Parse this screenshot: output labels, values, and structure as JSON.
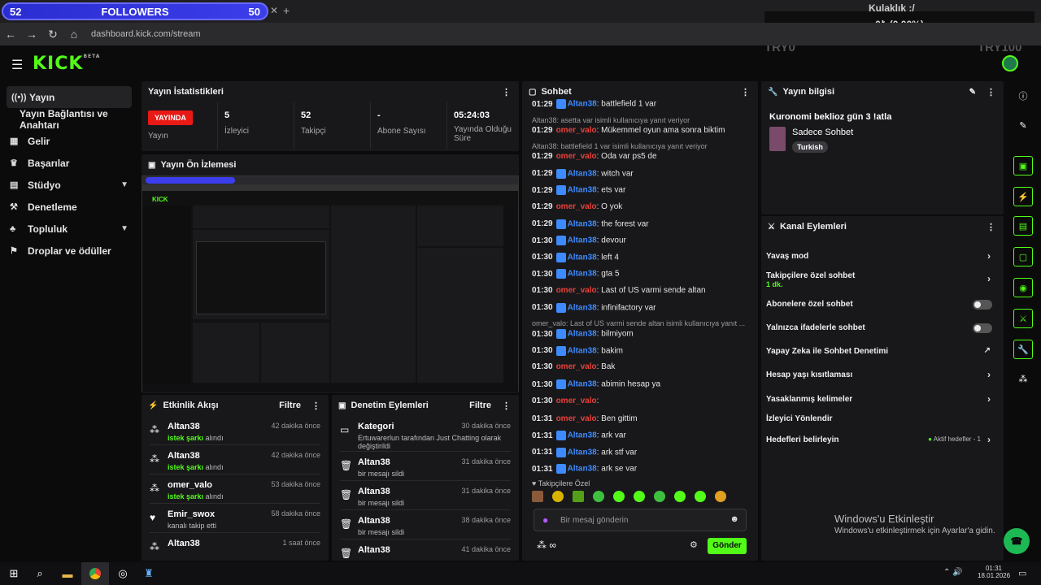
{
  "overlay": {
    "followers_left": "52",
    "followers_label": "FOLLOWERS",
    "followers_right": "50",
    "top_title": "Kulaklık :/",
    "top_amount": "0₺ (0.00%)",
    "try0": "TRY0",
    "try100": "TRY100"
  },
  "browser": {
    "url": "dashboard.kick.com/stream"
  },
  "logo": {
    "text": "KICK",
    "beta": "BETA"
  },
  "sidebar": {
    "items": [
      {
        "label": "Yayın",
        "icon": "broadcast-icon"
      },
      {
        "label": "Yayın Bağlantısı ve Anahtarı",
        "icon": ""
      },
      {
        "label": "Gelir",
        "icon": "revenue-icon"
      },
      {
        "label": "Başarılar",
        "icon": "trophy-icon"
      },
      {
        "label": "Stüdyo",
        "icon": "studio-icon"
      },
      {
        "label": "Denetleme",
        "icon": "moderation-icon"
      },
      {
        "label": "Topluluk",
        "icon": "community-icon"
      },
      {
        "label": "Droplar ve ödüller",
        "icon": "drops-icon"
      }
    ]
  },
  "stats": {
    "title": "Yayın İstatistikleri",
    "live": "YAYINDA",
    "live_label": "Yayın",
    "viewers": "5",
    "viewers_label": "İzleyici",
    "followers": "52",
    "followers_label": "Takipçi",
    "subs": "-",
    "subs_label": "Abone Sayısı",
    "uptime": "05:24:03",
    "uptime_label": "Yayında Olduğu Süre"
  },
  "preview": {
    "title": "Yayın Ön İzlemesi"
  },
  "activity": {
    "title": "Etkinlik Akışı",
    "filter": "Filtre",
    "rows": [
      {
        "name": "Altan38",
        "sub_b": "istek şarkı",
        "sub": " alındı",
        "time": "42 dakika önce"
      },
      {
        "name": "Altan38",
        "sub_b": "istek şarkı",
        "sub": " alındı",
        "time": "42 dakika önce"
      },
      {
        "name": "omer_valo",
        "sub_b": "istek şarkı",
        "sub": " alındı",
        "time": "53 dakika önce"
      },
      {
        "name": "Emir_swox",
        "sub_b": "",
        "sub": "kanalı takip etti",
        "time": "58 dakika önce"
      },
      {
        "name": "Altan38",
        "sub_b": "",
        "sub": "",
        "time": "1 saat önce"
      }
    ]
  },
  "modactions": {
    "title": "Denetim Eylemleri",
    "filter": "Filtre",
    "rows": [
      {
        "name": "Kategori",
        "time": "30 dakika önce",
        "sub": "Ertuwarerlun tarafından Just Chatting olarak değiştirildi"
      },
      {
        "name": "Altan38",
        "time": "31 dakika önce",
        "sub": "bir mesajı sildi"
      },
      {
        "name": "Altan38",
        "time": "31 dakika önce",
        "sub": "bir mesajı sildi"
      },
      {
        "name": "Altan38",
        "time": "38 dakika önce",
        "sub": "bir mesajı sildi"
      },
      {
        "name": "Altan38",
        "time": "41 dakika önce",
        "sub": ""
      }
    ]
  },
  "chat": {
    "title": "Sohbet",
    "followers_only": "Takipçilere Özel",
    "placeholder": "Bir mesaj gönderin",
    "send": "Gönder",
    "messages": [
      {
        "type": "msg",
        "time": "01:29",
        "user": "Altan38",
        "uc": "u1",
        "text": ": battlefield 1 var"
      },
      {
        "type": "reply",
        "text": "Altan38: asetta var isimli kullanıcıya yanıt veriyor"
      },
      {
        "type": "msg",
        "time": "01:29",
        "user": "omer_valo",
        "uc": "u2",
        "text": ": Mükemmel oyun ama sonra biktim"
      },
      {
        "type": "reply",
        "text": "Altan38: battlefield 1 var isimli kullanıcıya yanıt veriyor"
      },
      {
        "type": "msg",
        "time": "01:29",
        "user": "omer_valo",
        "uc": "u2",
        "text": ": Oda var ps5 de"
      },
      {
        "type": "msg",
        "time": "01:29",
        "user": "Altan38",
        "uc": "u1",
        "text": ": witch var"
      },
      {
        "type": "msg",
        "time": "01:29",
        "user": "Altan38",
        "uc": "u1",
        "text": ": ets var"
      },
      {
        "type": "msg",
        "time": "01:29",
        "user": "omer_valo",
        "uc": "u2",
        "text": ": O yok"
      },
      {
        "type": "msg",
        "time": "01:29",
        "user": "Altan38",
        "uc": "u1",
        "text": ": the forest var"
      },
      {
        "type": "msg",
        "time": "01:30",
        "user": "Altan38",
        "uc": "u1",
        "text": ": devour"
      },
      {
        "type": "msg",
        "time": "01:30",
        "user": "Altan38",
        "uc": "u1",
        "text": ": left 4"
      },
      {
        "type": "msg",
        "time": "01:30",
        "user": "Altan38",
        "uc": "u1",
        "text": ": gta 5"
      },
      {
        "type": "msg",
        "time": "01:30",
        "user": "omer_valo",
        "uc": "u2",
        "text": ": Last of US varmi sende altan"
      },
      {
        "type": "msg",
        "time": "01:30",
        "user": "Altan38",
        "uc": "u1",
        "text": ": infinifactory var"
      },
      {
        "type": "reply",
        "text": "omer_valo: Last of US varmi sende altan isimli kullanıcıya yanıt ..."
      },
      {
        "type": "msg",
        "time": "01:30",
        "user": "Altan38",
        "uc": "u1",
        "text": ": bilmiyom"
      },
      {
        "type": "msg",
        "time": "01:30",
        "user": "Altan38",
        "uc": "u1",
        "text": ": bakim"
      },
      {
        "type": "msg",
        "time": "01:30",
        "user": "omer_valo",
        "uc": "u2",
        "text": ": Bak"
      },
      {
        "type": "msg",
        "time": "01:30",
        "user": "Altan38",
        "uc": "u1",
        "text": ": abimin hesap ya"
      },
      {
        "type": "msg",
        "time": "01:30",
        "user": "omer_valo",
        "uc": "u2",
        "text": ": "
      },
      {
        "type": "msg",
        "time": "01:31",
        "user": "omer_valo",
        "uc": "u2",
        "text": ": Ben gittim"
      },
      {
        "type": "msg",
        "time": "01:31",
        "user": "Altan38",
        "uc": "u1",
        "text": ": ark var"
      },
      {
        "type": "msg",
        "time": "01:31",
        "user": "Altan38",
        "uc": "u1",
        "text": ": ark stf var"
      },
      {
        "type": "msg",
        "time": "01:31",
        "user": "Altan38",
        "uc": "u1",
        "text": ": ark se var"
      }
    ]
  },
  "streaminfo": {
    "title": "Yayın bilgisi",
    "stream_title": "Kuronomi beklioz gün 3 !atla",
    "category": "Sadece Sohbet",
    "language": "Turkish"
  },
  "channel": {
    "title": "Kanal Eylemleri",
    "items": [
      {
        "label": "Yavaş mod",
        "sub": "",
        "ctl": "chev"
      },
      {
        "label": "Takipçilere özel sohbet",
        "sub": "1 dk.",
        "ctl": "chev"
      },
      {
        "label": "Abonelere özel sohbet",
        "sub": "",
        "ctl": "toggle"
      },
      {
        "label": "Yalnızca ifadelerle sohbet",
        "sub": "",
        "ctl": "toggle"
      },
      {
        "label": "Yapay Zeka ile Sohbet Denetimi",
        "sub": "",
        "ctl": "ext"
      },
      {
        "label": "Hesap yaşı kısıtlaması",
        "sub": "",
        "ctl": "chev"
      },
      {
        "label": "Yasaklanmış kelimeler",
        "sub": "",
        "ctl": "chev"
      },
      {
        "label": "İzleyici Yönlendir",
        "sub": "",
        "ctl": ""
      },
      {
        "label": "Hedefleri belirleyin",
        "sub": "",
        "ctl": "chev"
      }
    ],
    "goals_status": "Aktif hedefler - 1"
  },
  "watermark": {
    "line1": "Windows'u Etkinleştir",
    "line2": "Windows'u etkinleştirmek için Ayarlar'a gidin."
  },
  "clock": {
    "time": "01:31",
    "date": "18.01.2026"
  },
  "colors": {
    "accent": "#53fc18",
    "live": "#e91916",
    "user_blue": "#3d8bff",
    "user_red": "#e8413a"
  }
}
